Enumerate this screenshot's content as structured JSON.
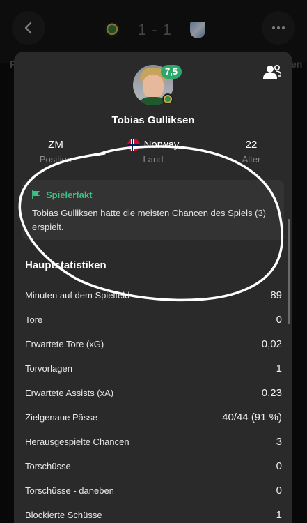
{
  "header": {
    "score": "1 - 1",
    "peek_left": "F",
    "peek_right": "en"
  },
  "player": {
    "name": "Tobias Gulliksen",
    "rating": "7,5",
    "position_value": "ZM",
    "position_label": "Position",
    "country_value": "Norway",
    "country_label": "Land",
    "age_value": "22",
    "age_label": "Alter"
  },
  "fact": {
    "title": "Spielerfakt",
    "text": "Tobias Gulliksen hatte die meisten Chancen des Spiels (3) erspielt."
  },
  "stats": {
    "title": "Hauptstatistiken",
    "rows": [
      {
        "name": "Minuten auf dem Spielfeld",
        "value": "89"
      },
      {
        "name": "Tore",
        "value": "0"
      },
      {
        "name": "Erwartete Tore (xG)",
        "value": "0,02"
      },
      {
        "name": "Torvorlagen",
        "value": "1"
      },
      {
        "name": "Erwartete Assists (xA)",
        "value": "0,23"
      },
      {
        "name": "Zielgenaue Pässe",
        "value": "40/44 (91 %)"
      },
      {
        "name": "Herausgespielte Chancen",
        "value": "3"
      },
      {
        "name": "Torschüsse",
        "value": "0"
      },
      {
        "name": "Torschüsse - daneben",
        "value": "0"
      },
      {
        "name": "Blockierte Schüsse",
        "value": "1"
      }
    ]
  },
  "colors": {
    "accent_green": "#3fbf7f",
    "rating_green": "#2fa66a",
    "modal_bg": "#2a2a2a",
    "card_bg": "#333333"
  }
}
